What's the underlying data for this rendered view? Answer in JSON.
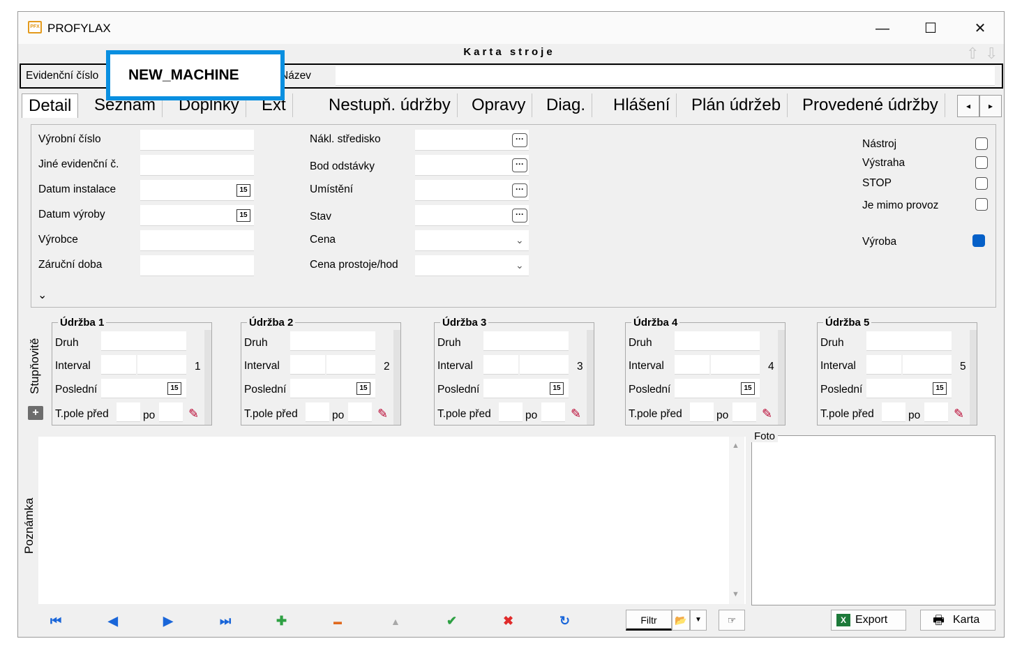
{
  "window": {
    "title": "PROFYLAX",
    "icon_label": "PFX",
    "minimize": "—",
    "maximize": "☐",
    "close": "✕"
  },
  "form": {
    "title": "Karta stroje",
    "nav_up": "⇧",
    "nav_down": "⇩",
    "evidencni_label": "Evidenční číslo",
    "evidencni_value": "NEW_MACHINE",
    "nazev_label": "Název",
    "nazev_value": ""
  },
  "tabs": [
    "Detail",
    "Seznam",
    "Doplňky",
    "Ext",
    "Nestupň. údržby",
    "Opravy",
    "Diag.",
    "Hlášení",
    "Plán údržeb",
    "Provedené údržby"
  ],
  "tab_scroll": {
    "left": "◂",
    "right": "▸"
  },
  "detail": {
    "left_labels": [
      "Výrobní číslo",
      "Jiné evidenční č.",
      "Datum instalace",
      "Datum výroby",
      "Výrobce",
      "Záruční doba"
    ],
    "mid_labels": [
      "Nákl. středisko",
      "Bod odstávky",
      "Umístění",
      "Stav",
      "Cena",
      "Cena prostoje/hod"
    ],
    "calendar_icon": "15",
    "dots_icon": "···",
    "chevron_down": "⌄",
    "expand_icon": "≫",
    "flags": [
      {
        "label": "Nástroj",
        "checked": false
      },
      {
        "label": "Výstraha",
        "checked": false
      },
      {
        "label": "STOP",
        "checked": false
      },
      {
        "label": "Je mimo provoz",
        "checked": false
      }
    ],
    "vyroba_label": "Výroba",
    "vyroba_checked": true
  },
  "stupnovite_label": "Stupňovitě",
  "plus_icon": "+",
  "udrzby": [
    {
      "title": "Údržba 1",
      "num": "1"
    },
    {
      "title": "Údržba 2",
      "num": "2"
    },
    {
      "title": "Údržba 3",
      "num": "3"
    },
    {
      "title": "Údržba 4",
      "num": "4"
    },
    {
      "title": "Údržba 5",
      "num": "5"
    }
  ],
  "udrzba_labels": {
    "druh": "Druh",
    "interval": "Interval",
    "posledni": "Poslední",
    "tpole": "T.pole před",
    "po": "po"
  },
  "poznamka_label": "Poznámka",
  "foto_label": "Foto",
  "bottom": {
    "nav": [
      "⏮",
      "◀",
      "▶",
      "⏭"
    ],
    "add": "✚",
    "remove": "▬",
    "up": "▲",
    "confirm": "✔",
    "cancel": "✖",
    "refresh": "↻",
    "filtr": "Filtr",
    "export": "Export",
    "karta": "Karta"
  },
  "colors": {
    "highlight": "#0a8fe0",
    "vyroba_checkbox": "#0560c8",
    "add": "#2ea043",
    "remove": "#e06a1f",
    "confirm": "#2ea043",
    "cancel": "#e02b2b",
    "nav": "#1a66d9"
  }
}
